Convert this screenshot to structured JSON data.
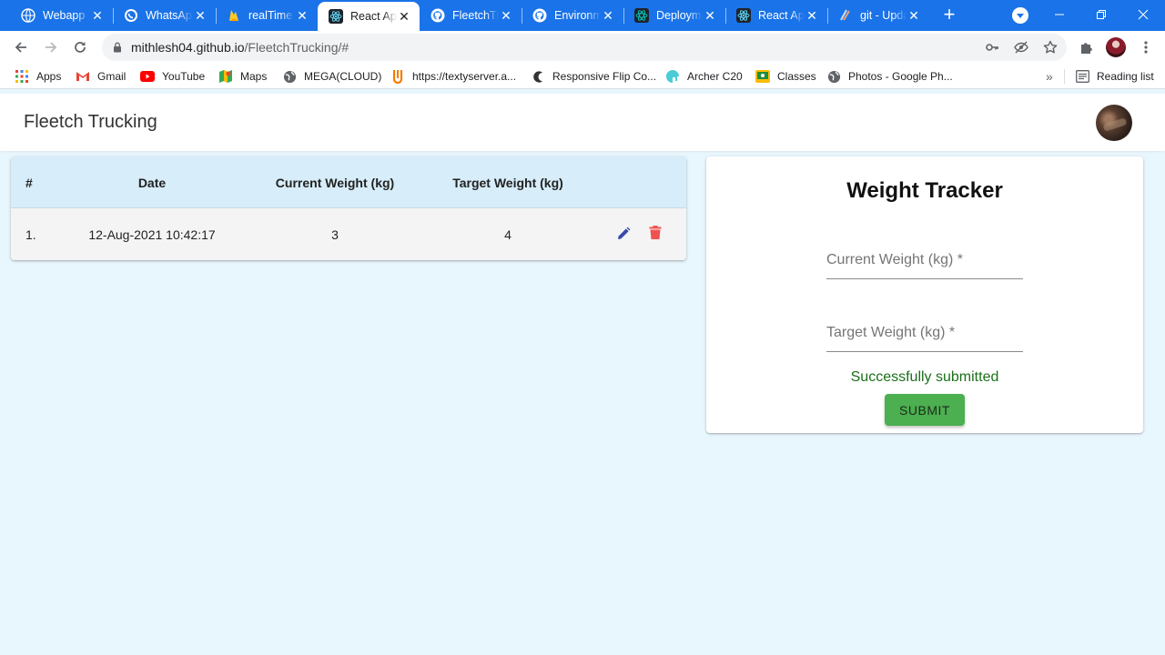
{
  "browser": {
    "tabs": [
      {
        "title": "Webapp",
        "icon": "globe-icon"
      },
      {
        "title": "WhatsApp",
        "icon": "whatsapp-icon"
      },
      {
        "title": "realTime",
        "icon": "firebase-icon"
      },
      {
        "title": "React App",
        "icon": "react-icon",
        "active": true
      },
      {
        "title": "FleetchTrucking",
        "icon": "github-icon"
      },
      {
        "title": "Environments",
        "icon": "github-icon"
      },
      {
        "title": "Deployments",
        "icon": "react-icon"
      },
      {
        "title": "React App",
        "icon": "react-icon"
      },
      {
        "title": "git - Update",
        "icon": "git-icon"
      }
    ],
    "new_tab": "+",
    "url_host": "mithlesh04.github.io",
    "url_path": "/FleetchTrucking/#",
    "bookmarks": [
      {
        "label": "Apps",
        "icon": "apps-grid-icon"
      },
      {
        "label": "Gmail",
        "icon": "gmail-icon"
      },
      {
        "label": "YouTube",
        "icon": "youtube-icon"
      },
      {
        "label": "Maps",
        "icon": "maps-icon"
      },
      {
        "label": "MEGA(CLOUD)",
        "icon": "globe-icon"
      },
      {
        "label": "https://textyserver.a...",
        "icon": "texty-icon"
      },
      {
        "label": "Responsive Flip Co...",
        "icon": "flip-icon"
      },
      {
        "label": "Archer C20",
        "icon": "archer-icon"
      },
      {
        "label": "Classes",
        "icon": "classes-icon"
      },
      {
        "label": "Photos - Google Ph...",
        "icon": "globe-icon"
      }
    ],
    "more_bookmarks": "»",
    "reading_list": "Reading list",
    "accent_color": "#1a73e8"
  },
  "app": {
    "brand": "Fleetch Trucking",
    "table": {
      "headers": [
        "#",
        "Date",
        "Current Weight (kg)",
        "Target Weight (kg)"
      ],
      "rows": [
        {
          "index": "1.",
          "date": "12-Aug-2021 10:42:17",
          "current": "3",
          "target": "4"
        }
      ]
    },
    "form": {
      "title": "Weight Tracker",
      "current_label": "Current Weight (kg) *",
      "target_label": "Target Weight (kg) *",
      "success_message": "Successfully submitted",
      "submit_label": "SUBMIT"
    },
    "colors": {
      "background": "#e8f6fd",
      "table_header": "#d7edf9",
      "edit_icon": "#3949ab",
      "delete_icon": "#ef5350",
      "submit": "#4caf50",
      "success_text": "#1b6f1b"
    }
  }
}
